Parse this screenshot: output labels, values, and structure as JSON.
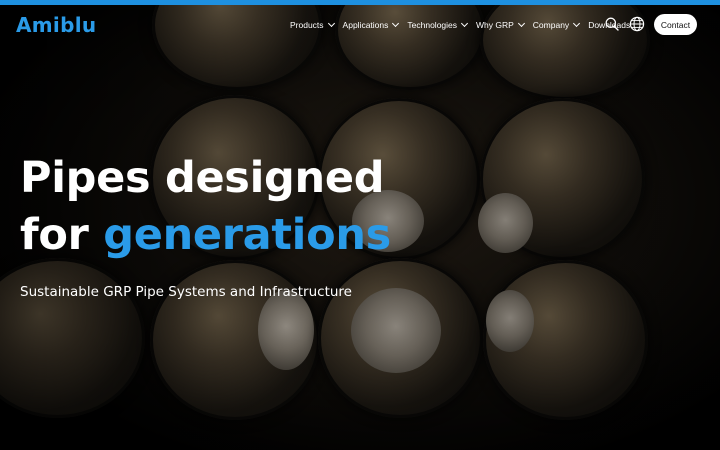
{
  "brand": {
    "logo_text": "Amiblu",
    "accent_color": "#2a9be8",
    "bar_color": "#1e90e0"
  },
  "nav": {
    "items": [
      {
        "label": "Products",
        "has_dropdown": true
      },
      {
        "label": "Applications",
        "has_dropdown": true
      },
      {
        "label": "Technologies",
        "has_dropdown": true
      },
      {
        "label": "Why GRP",
        "has_dropdown": true
      },
      {
        "label": "Company",
        "has_dropdown": true
      },
      {
        "label": "Downloads",
        "has_dropdown": false
      }
    ],
    "icons": [
      "search-icon",
      "globe-icon"
    ],
    "contact_label": "Contact"
  },
  "hero": {
    "headline_line1": "Pipes designed",
    "headline_line2_plain": "for ",
    "headline_line2_accent": "generations",
    "subheadline": "Sustainable GRP Pipe Systems and Infrastructure"
  }
}
